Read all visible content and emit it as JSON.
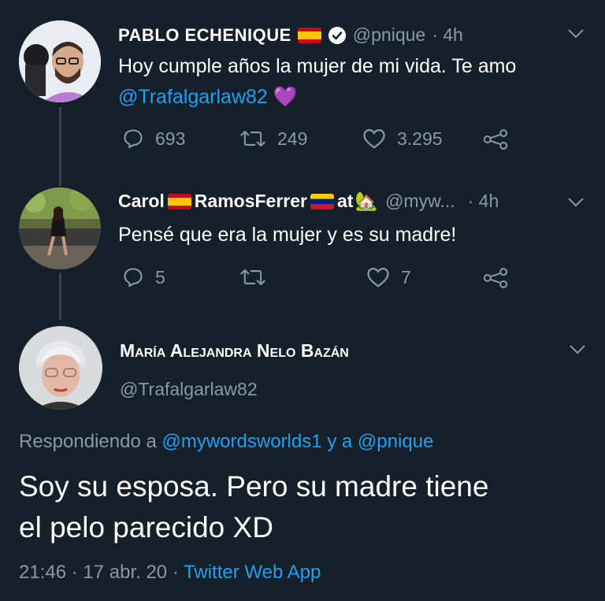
{
  "tweet1": {
    "name": "PABLO ECHENIQUE",
    "handle": "@pnique",
    "time": "· 4h",
    "text_line1": "Hoy cumple años la mujer de mi vida. Te amo",
    "mention": "@Trafalgarlaw82",
    "heart_emoji": "💜",
    "replies": "693",
    "retweets": "249",
    "likes": "3.295"
  },
  "tweet2": {
    "name_part1": "Carol",
    "name_part2": "RamosFerrer",
    "name_part3": "at",
    "house_emoji": "🏡",
    "handle": "@myw...",
    "time": "· 4h",
    "text": "Pensé que era la mujer y es su madre!",
    "replies": "5",
    "retweets": "",
    "likes": "7"
  },
  "tweet3": {
    "name": "María Alejandra Nelo Bazán",
    "handle": "@Trafalgarlaw82",
    "replying_prefix": "Respondiendo a",
    "reply_to_1": "@mywordsworlds1",
    "reply_connector": "y a",
    "reply_to_2": "@pnique",
    "text_line1": "Soy su esposa. Pero su madre tiene",
    "text_line2": "el pelo parecido XD",
    "timestamp": "21:46 · 17 abr. 20 ·",
    "source": "Twitter Web App"
  },
  "colors": {
    "background": "#15202b",
    "muted": "#8899a6",
    "link": "#1da1f2",
    "thread_line": "#38444d"
  }
}
